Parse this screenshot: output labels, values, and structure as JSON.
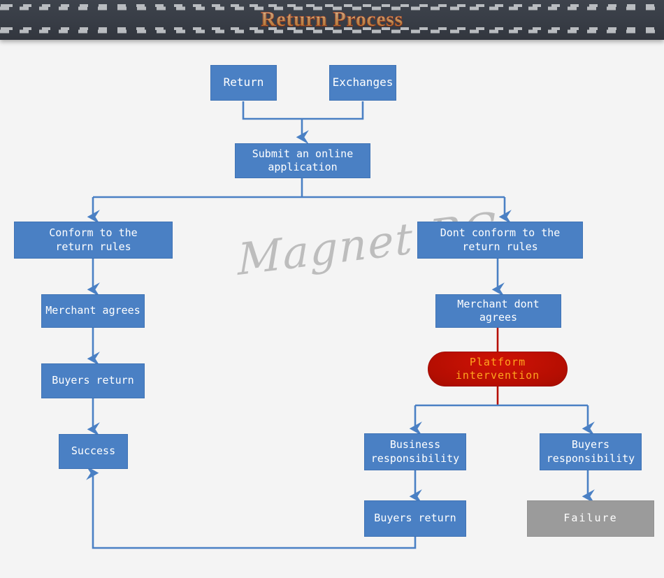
{
  "header": {
    "title": "Return Process"
  },
  "watermark": {
    "text": "Magnet BG"
  },
  "colors": {
    "background": "#f4f4f4",
    "header_bg": "#393e47",
    "title_gold": "#f0cd7e",
    "title_outline": "#8d2b12",
    "node_blue": "#4a80c4",
    "node_blue_border": "#3f73b5",
    "node_gray": "#9b9b9b",
    "pill_red": "#b50e02",
    "pill_text_orange": "#ffa51f",
    "connector_blue": "#4a80c4",
    "connector_red": "#b50e02",
    "watermark_gray": "#a8a8a8"
  },
  "chart_data": {
    "type": "diagram",
    "title": "Return Process",
    "nodes": [
      {
        "id": "return",
        "label": "Return",
        "shape": "rect",
        "style": "blue"
      },
      {
        "id": "exchanges",
        "label": "Exchanges",
        "shape": "rect",
        "style": "blue"
      },
      {
        "id": "submit",
        "label": "Submit an online\napplication",
        "shape": "rect",
        "style": "blue"
      },
      {
        "id": "conform",
        "label": "Conform to the\nreturn rules",
        "shape": "rect",
        "style": "blue"
      },
      {
        "id": "dont-conform",
        "label": "Dont conform to the\nreturn rules",
        "shape": "rect",
        "style": "blue"
      },
      {
        "id": "merchant-agrees",
        "label": "Merchant agrees",
        "shape": "rect",
        "style": "blue"
      },
      {
        "id": "merchant-dont",
        "label": "Merchant dont agrees",
        "shape": "rect",
        "style": "blue"
      },
      {
        "id": "buyers-return-left",
        "label": "Buyers return",
        "shape": "rect",
        "style": "blue"
      },
      {
        "id": "platform",
        "label": "Platform\nintervention",
        "shape": "pill",
        "style": "red"
      },
      {
        "id": "success",
        "label": "Success",
        "shape": "rect",
        "style": "blue"
      },
      {
        "id": "business-resp",
        "label": "Business\nresponsibility",
        "shape": "rect",
        "style": "blue"
      },
      {
        "id": "buyers-resp",
        "label": "Buyers\nresponsibility",
        "shape": "rect",
        "style": "blue"
      },
      {
        "id": "buyers-return-mid",
        "label": "Buyers return",
        "shape": "rect",
        "style": "blue"
      },
      {
        "id": "failure",
        "label": "Failure",
        "shape": "rect",
        "style": "gray"
      }
    ],
    "edges": [
      {
        "from": "return",
        "to": "submit"
      },
      {
        "from": "exchanges",
        "to": "submit"
      },
      {
        "from": "submit",
        "to": "conform"
      },
      {
        "from": "submit",
        "to": "dont-conform"
      },
      {
        "from": "conform",
        "to": "merchant-agrees"
      },
      {
        "from": "merchant-agrees",
        "to": "buyers-return-left"
      },
      {
        "from": "buyers-return-left",
        "to": "success"
      },
      {
        "from": "dont-conform",
        "to": "merchant-dont"
      },
      {
        "from": "merchant-dont",
        "to": "platform"
      },
      {
        "from": "platform",
        "to": "business-resp"
      },
      {
        "from": "platform",
        "to": "buyers-resp"
      },
      {
        "from": "business-resp",
        "to": "buyers-return-mid"
      },
      {
        "from": "buyers-resp",
        "to": "failure"
      },
      {
        "from": "buyers-return-mid",
        "to": "success"
      }
    ]
  },
  "nodes": {
    "return": "Return",
    "exchanges": "Exchanges",
    "submit": "Submit an online\napplication",
    "conform": "Conform to the\nreturn rules",
    "dont_conform": "Dont conform to the\nreturn rules",
    "merchant_agrees": "Merchant agrees",
    "merchant_dont_agrees": "Merchant dont agrees",
    "buyers_return_left": "Buyers return",
    "platform_intervention": "Platform\nintervention",
    "success": "Success",
    "business_responsibility": "Business\nresponsibility",
    "buyers_responsibility": "Buyers\nresponsibility",
    "buyers_return_mid": "Buyers return",
    "failure": "Failure"
  }
}
